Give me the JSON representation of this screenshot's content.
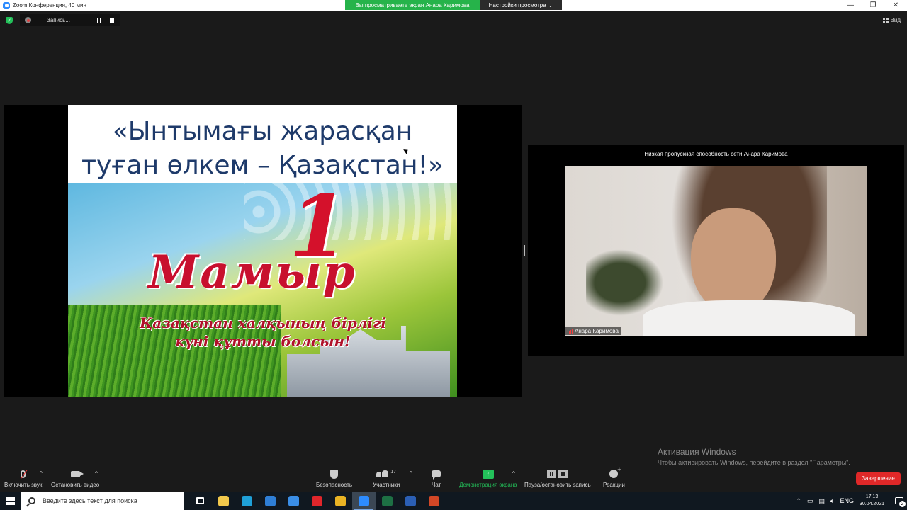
{
  "window": {
    "title": "Zoom Конференция, 40 мин",
    "share_banner": "Вы просматриваете экран Анара Каримова",
    "view_settings": "Настройки просмотра",
    "controls": [
      "—",
      "❐",
      "✕"
    ]
  },
  "recording": {
    "label": "Запись..."
  },
  "view_button": "Вид",
  "slide": {
    "heading_line1": "«Ынтымағы жарасқан",
    "heading_line2": "туған өлкем – Қазақстан!»",
    "number": "1",
    "month": "Мамыр",
    "greeting_line1": "Қазақстан халқының бірлігі",
    "greeting_line2": "күні құтты болсын!"
  },
  "video": {
    "bandwidth_notice": "Низкая пропускная способность сети Анара Каримова",
    "participant_name": "Анара Каримова"
  },
  "watermark": {
    "title": "Активация Windows",
    "subtitle": "Чтобы активировать Windows, перейдите в раздел \"Параметры\"."
  },
  "toolbar": {
    "unmute": "Включить звук",
    "stop_video": "Остановить видео",
    "security": "Безопасность",
    "participants": "Участники",
    "participants_count": "17",
    "chat": "Чат",
    "share_screen": "Демонстрация экрана",
    "pause_stop_recording": "Пауза/остановить запись",
    "reactions": "Реакции",
    "end": "Завершение"
  },
  "taskbar": {
    "search_placeholder": "Введите здесь текст для поиска",
    "language": "ENG",
    "time": "17:13",
    "date": "30.04.2021",
    "notifications_count": "2",
    "apps": [
      {
        "name": "task-view-icon",
        "color": "#101820"
      },
      {
        "name": "file-explorer-icon",
        "color": "#f2c94c"
      },
      {
        "name": "edge-icon",
        "color": "#1fa0d8"
      },
      {
        "name": "mail-icon",
        "color": "#2f7fd6"
      },
      {
        "name": "store-icon",
        "color": "#3a8ee6"
      },
      {
        "name": "opera-icon",
        "color": "#e0262b"
      },
      {
        "name": "chrome-icon",
        "color": "#e8b324"
      },
      {
        "name": "zoom-icon",
        "color": "#2d8cff"
      },
      {
        "name": "excel-icon",
        "color": "#1d7044"
      },
      {
        "name": "word-icon",
        "color": "#2b5fb5"
      },
      {
        "name": "powerpoint-icon",
        "color": "#d24726"
      }
    ]
  }
}
